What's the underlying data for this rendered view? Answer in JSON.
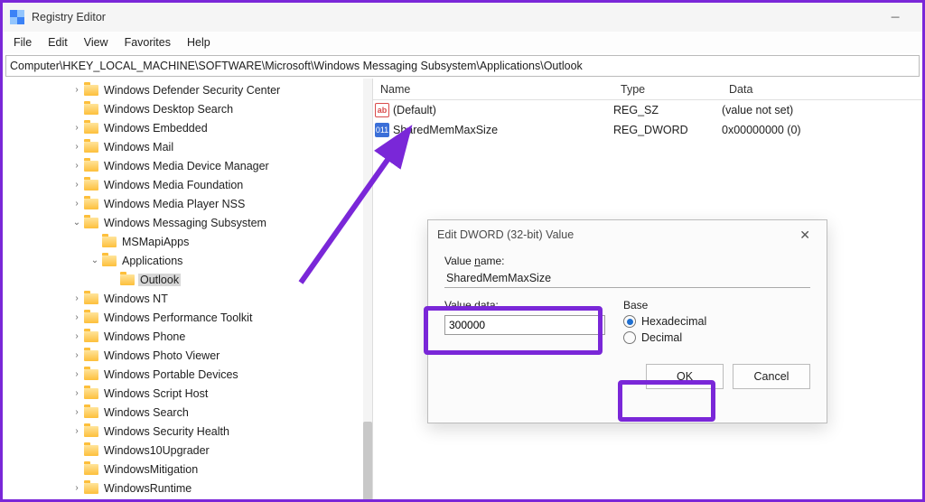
{
  "window": {
    "title": "Registry Editor"
  },
  "menu": {
    "file": "File",
    "edit": "Edit",
    "view": "View",
    "favorites": "Favorites",
    "help": "Help"
  },
  "address": "Computer\\HKEY_LOCAL_MACHINE\\SOFTWARE\\Microsoft\\Windows Messaging Subsystem\\Applications\\Outlook",
  "tree": [
    {
      "indent": 76,
      "exp": "›",
      "label": "Windows Defender Security Center"
    },
    {
      "indent": 76,
      "exp": "",
      "label": "Windows Desktop Search"
    },
    {
      "indent": 76,
      "exp": "›",
      "label": "Windows Embedded"
    },
    {
      "indent": 76,
      "exp": "›",
      "label": "Windows Mail"
    },
    {
      "indent": 76,
      "exp": "›",
      "label": "Windows Media Device Manager"
    },
    {
      "indent": 76,
      "exp": "›",
      "label": "Windows Media Foundation"
    },
    {
      "indent": 76,
      "exp": "›",
      "label": "Windows Media Player NSS"
    },
    {
      "indent": 76,
      "exp": "⌄",
      "label": "Windows Messaging Subsystem"
    },
    {
      "indent": 96,
      "exp": "",
      "label": "MSMapiApps"
    },
    {
      "indent": 96,
      "exp": "⌄",
      "label": "Applications"
    },
    {
      "indent": 116,
      "exp": "",
      "label": "Outlook",
      "selected": true
    },
    {
      "indent": 76,
      "exp": "›",
      "label": "Windows NT"
    },
    {
      "indent": 76,
      "exp": "›",
      "label": "Windows Performance Toolkit"
    },
    {
      "indent": 76,
      "exp": "›",
      "label": "Windows Phone"
    },
    {
      "indent": 76,
      "exp": "›",
      "label": "Windows Photo Viewer"
    },
    {
      "indent": 76,
      "exp": "›",
      "label": "Windows Portable Devices"
    },
    {
      "indent": 76,
      "exp": "›",
      "label": "Windows Script Host"
    },
    {
      "indent": 76,
      "exp": "›",
      "label": "Windows Search"
    },
    {
      "indent": 76,
      "exp": "›",
      "label": "Windows Security Health"
    },
    {
      "indent": 76,
      "exp": "",
      "label": "Windows10Upgrader"
    },
    {
      "indent": 76,
      "exp": "",
      "label": "WindowsMitigation"
    },
    {
      "indent": 76,
      "exp": "›",
      "label": "WindowsRuntime"
    }
  ],
  "list": {
    "headers": {
      "name": "Name",
      "type": "Type",
      "data": "Data"
    },
    "rows": [
      {
        "icon": "string",
        "name": "(Default)",
        "type": "REG_SZ",
        "data": "(value not set)"
      },
      {
        "icon": "dword",
        "name": "SharedMemMaxSize",
        "type": "REG_DWORD",
        "data": "0x00000000 (0)"
      }
    ]
  },
  "dialog": {
    "title": "Edit DWORD (32-bit) Value",
    "value_name_label": "Value name:",
    "value_name": "SharedMemMaxSize",
    "value_data_label": "Value data:",
    "value_data": "300000",
    "base_label": "Base",
    "hex_label": "Hexadecimal",
    "dec_label": "Decimal",
    "ok": "OK",
    "cancel": "Cancel"
  }
}
